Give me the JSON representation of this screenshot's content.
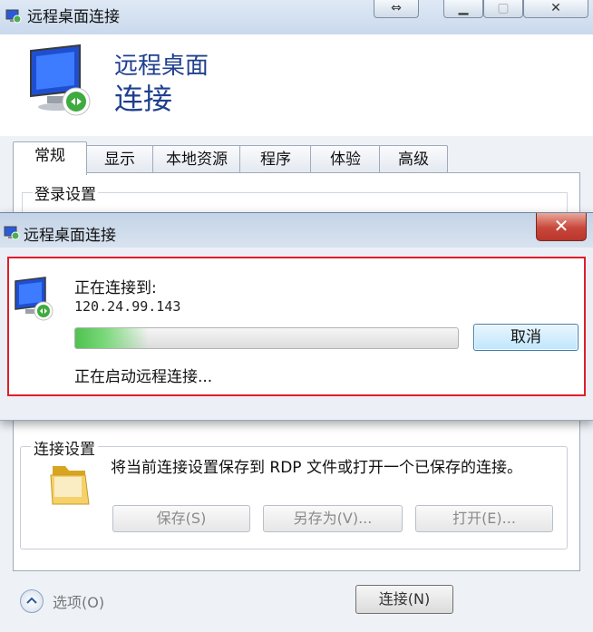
{
  "back_window": {
    "title": "远程桌面连接",
    "header": {
      "line1": "远程桌面",
      "line2": "连接"
    },
    "tabs": [
      "常规",
      "显示",
      "本地资源",
      "程序",
      "体验",
      "高级"
    ],
    "active_tab": "常规",
    "login_group_label": "登录设置",
    "connection_group": {
      "label": "连接设置",
      "description": "将当前连接设置保存到 RDP 文件或打开一个已保存的连接。",
      "save_button": "保存(S)",
      "save_as_button": "另存为(V)...",
      "open_button": "打开(E)..."
    },
    "options_label": "选项(O)",
    "connect_button": "连接(N)"
  },
  "dialog": {
    "title": "远程桌面连接",
    "close_glyph": "✕",
    "connecting_label": "正在连接到:",
    "ip_address": "120.24.99.143",
    "progress_fraction": 0.12,
    "cancel_button": "取消",
    "status_text": "正在启动远程连接..."
  },
  "colors": {
    "highlight_border": "#e11d2a",
    "progress": "#4fc24f",
    "header_text": "#1f3f8f"
  }
}
